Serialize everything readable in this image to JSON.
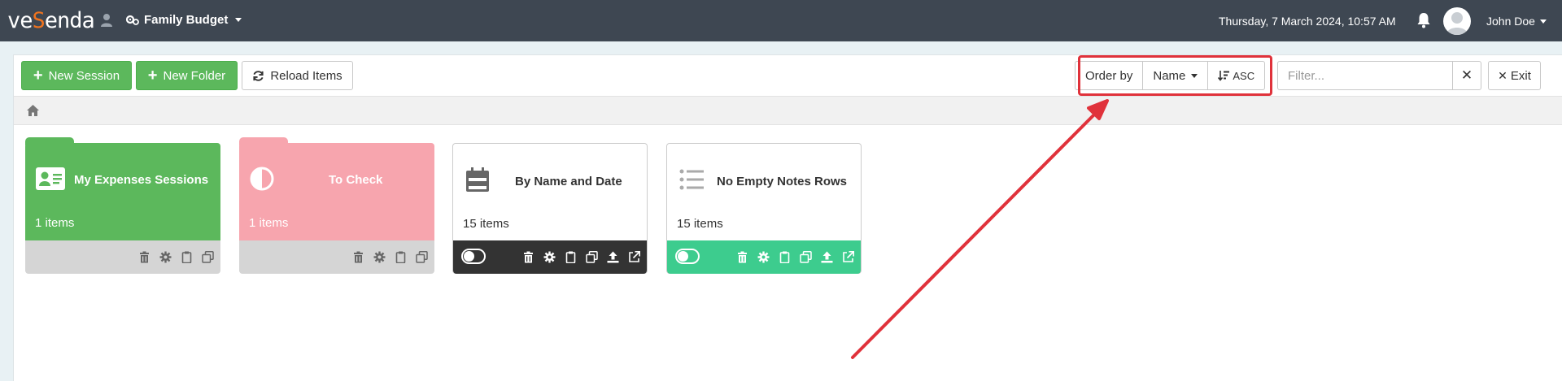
{
  "navbar": {
    "logo_pre": "ve",
    "logo_accent": "S",
    "logo_post": "enda",
    "project": "Family Budget",
    "datetime": "Thursday, 7 March 2024, 10:57 AM",
    "user": "John Doe"
  },
  "toolbar": {
    "new_session": "New Session",
    "new_folder": "New Folder",
    "reload": "Reload Items",
    "order_by": "Order by",
    "order_field": "Name",
    "order_dir": "ASC",
    "filter_placeholder": "Filter...",
    "exit": "Exit"
  },
  "tiles": [
    {
      "title": "My Expenses Sessions",
      "count": "1 items",
      "kind": "folder",
      "color": "#5cb85c"
    },
    {
      "title": "To Check",
      "count": "1 items",
      "kind": "folder",
      "color": "#f7a5ae"
    },
    {
      "title": "By Name and Date",
      "count": "15 items",
      "kind": "session",
      "color": "#333333"
    },
    {
      "title": "No Empty Notes Rows",
      "count": "15 items",
      "kind": "session",
      "color": "#3dcc8e"
    }
  ],
  "colors": {
    "navbar": "#3e4752",
    "accent": "#f0731e",
    "highlight": "#e0323b"
  }
}
